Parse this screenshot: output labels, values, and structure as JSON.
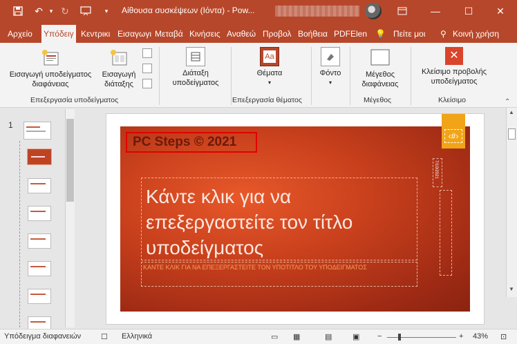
{
  "window": {
    "title": "Αίθουσα συσκέψεων (Ιόντα) - Pow...",
    "minimize": "—",
    "maximize": "☐",
    "close": "✕"
  },
  "tabs": [
    "Αρχείο",
    "Υπόδειγ",
    "Κεντρικι",
    "Εισαγωγι",
    "Μεταβά",
    "Κινήσεις",
    "Αναθεώ",
    "Προβολ",
    "Βοήθεια",
    "PDFElen",
    "Πείτε μοι",
    "Κοινή χρήση"
  ],
  "ribbon": {
    "insert_master": "Εισαγωγή υποδείγματος\nδιαφάνειας",
    "insert_layout": "Εισαγωγή\nδιάταξης",
    "group_edit_master": "Επεξεργασία υποδείγματος",
    "master_layout": "Διάταξη\nυποδείγματος",
    "themes": "Θέματα",
    "group_edit_theme": "Επεξεργασία θέματος",
    "background": "Φόντο",
    "slide_size": "Μέγεθος\nδιαφάνειας",
    "group_size": "Μέγεθος",
    "close_view": "Κλείσιμο προβολής\nυποδείγματος",
    "group_close": "Κλείσιμο"
  },
  "thumbs": {
    "number": "1"
  },
  "slide": {
    "watermark": "PC Steps © 2021",
    "title": "Κάντε κλικ για να επεξεργαστείτε τον τίτλο υποδείγματος",
    "subtitle": "ΚΑΝΤΕ ΚΛΙΚ ΓΙΑ ΝΑ ΕΠΕΞΕΡΓΑΣΤΕΙΤΕ ΤΟΝ ΥΠΟΤΙΤΛΟ ΤΟΥ ΥΠΟΔΕΙΓΜΑΤΟΣ",
    "number_placeholder": "‹#›",
    "date_placeholder": "7/10/2021"
  },
  "status": {
    "view": "Υπόδειγμα διαφανειών",
    "language": "Ελληνικά",
    "zoom": "43%"
  }
}
